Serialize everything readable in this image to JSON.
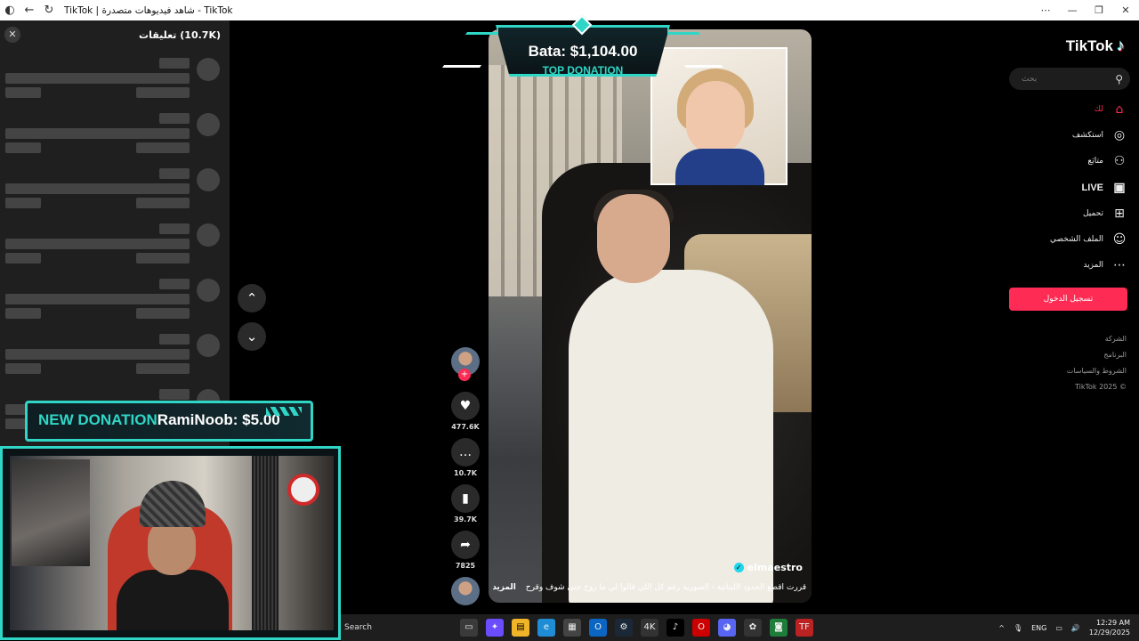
{
  "browser": {
    "title": "TikTok | شاهد فيديوهات متصدرة - TikTok",
    "back_icon": "arrow-left-icon",
    "reload_icon": "reload-icon"
  },
  "comments": {
    "header": "تعليقات (10.7K)",
    "close_glyph": "✕",
    "skeleton_rows": 7
  },
  "nav_arrows": {
    "up": "⌃",
    "down": "⌄"
  },
  "overlay": {
    "top_donation_amount": "Bata: $1,104.00",
    "top_donation_label": "TOP DONATION",
    "new_donation_label": "NEW DONATION",
    "new_donation_who": "RamiNoob: $5.00"
  },
  "video": {
    "username": "elmaestro",
    "caption": "قررت اقطع الحدود اللبنانية - السورية رغم كل اللي قالوا لي ما روح حتى شوف وقرح",
    "more": "المزيد"
  },
  "actions": {
    "likes": "477.6K",
    "comments": "10.7K",
    "saves": "39.7K",
    "shares": "7825"
  },
  "sidebar": {
    "logo": "TikTok",
    "search_placeholder": "بحث",
    "items": [
      {
        "label": "لك",
        "icon": "home-icon"
      },
      {
        "label": "استكشف",
        "icon": "compass-icon"
      },
      {
        "label": "متابَع",
        "icon": "user-plus-icon"
      },
      {
        "label": "LIVE",
        "icon": "live-tv-icon"
      },
      {
        "label": "تحميل",
        "icon": "upload-plus-icon"
      },
      {
        "label": "الملف الشخصي",
        "icon": "profile-icon"
      },
      {
        "label": "المزيد",
        "icon": "more-dots-icon"
      }
    ],
    "login": "تسجيل الدخول",
    "footer": [
      "الشركة",
      "البرنامج",
      "الشروط والسياسات",
      "© 2025 TikTok"
    ]
  },
  "taskbar": {
    "search": "Search",
    "language": "ENG",
    "time": "12:29 AM",
    "date": "12/29/2025"
  },
  "colors": {
    "accent": "#fe2c55",
    "overlay_teal": "#2fd6c6",
    "panel": "#1f1f1f"
  }
}
